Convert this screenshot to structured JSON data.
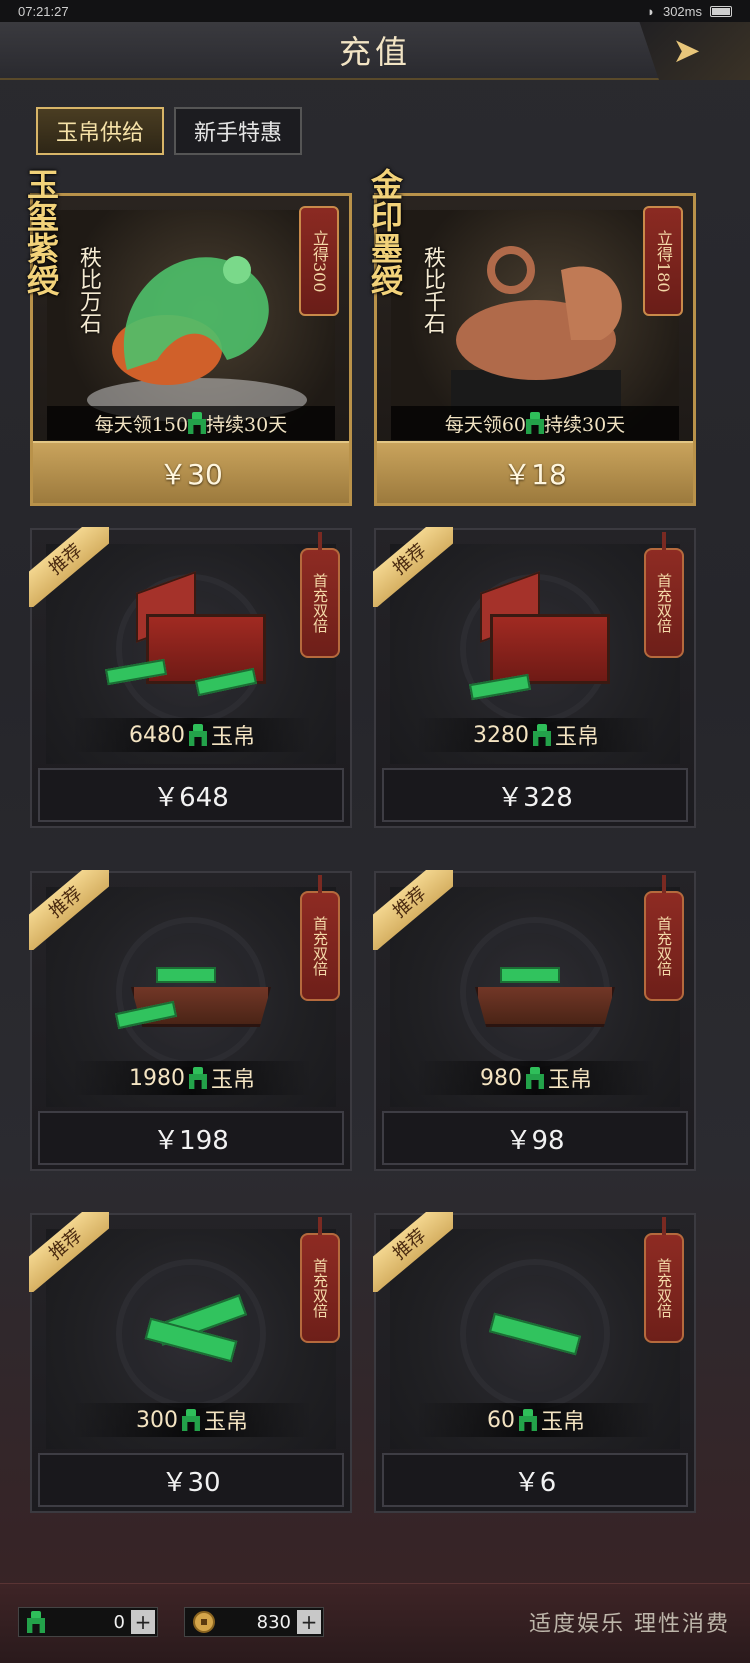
{
  "status": {
    "time": "07:21:27",
    "ping": "302ms"
  },
  "header": {
    "title": "充值",
    "back_icon": "arrow-right-icon"
  },
  "tabs": [
    {
      "label": "玉帛供给",
      "active": true
    },
    {
      "label": "新手特惠",
      "active": false
    }
  ],
  "monthly": [
    {
      "title": "玉玺紫绶",
      "subtitle": "秩比万石",
      "instant": "立得300",
      "daily": "每天领150",
      "duration": "持续30天",
      "price": "￥30"
    },
    {
      "title": "金印墨绶",
      "subtitle": "秩比千石",
      "instant": "立得180",
      "daily": "每天领60",
      "duration": "持续30天",
      "price": "￥18"
    }
  ],
  "packs": [
    {
      "ribbon": "推荐",
      "badge": "首充双倍",
      "amount": "6480",
      "unit": "玉帛",
      "price": "￥648",
      "art": "chest"
    },
    {
      "ribbon": "推荐",
      "badge": "首充双倍",
      "amount": "3280",
      "unit": "玉帛",
      "price": "￥328",
      "art": "chest"
    },
    {
      "ribbon": "推荐",
      "badge": "首充双倍",
      "amount": "1980",
      "unit": "玉帛",
      "price": "￥198",
      "art": "tray"
    },
    {
      "ribbon": "推荐",
      "badge": "首充双倍",
      "amount": "980",
      "unit": "玉帛",
      "price": "￥98",
      "art": "tray"
    },
    {
      "ribbon": "推荐",
      "badge": "首充双倍",
      "amount": "300",
      "unit": "玉帛",
      "price": "￥30",
      "art": "pile"
    },
    {
      "ribbon": "推荐",
      "badge": "首充双倍",
      "amount": "60",
      "unit": "玉帛",
      "price": "￥6",
      "art": "few"
    }
  ],
  "footer": {
    "jade_value": "0",
    "coin_value": "830",
    "plus_label": "+",
    "slogan": "适度娱乐 理性消费"
  }
}
